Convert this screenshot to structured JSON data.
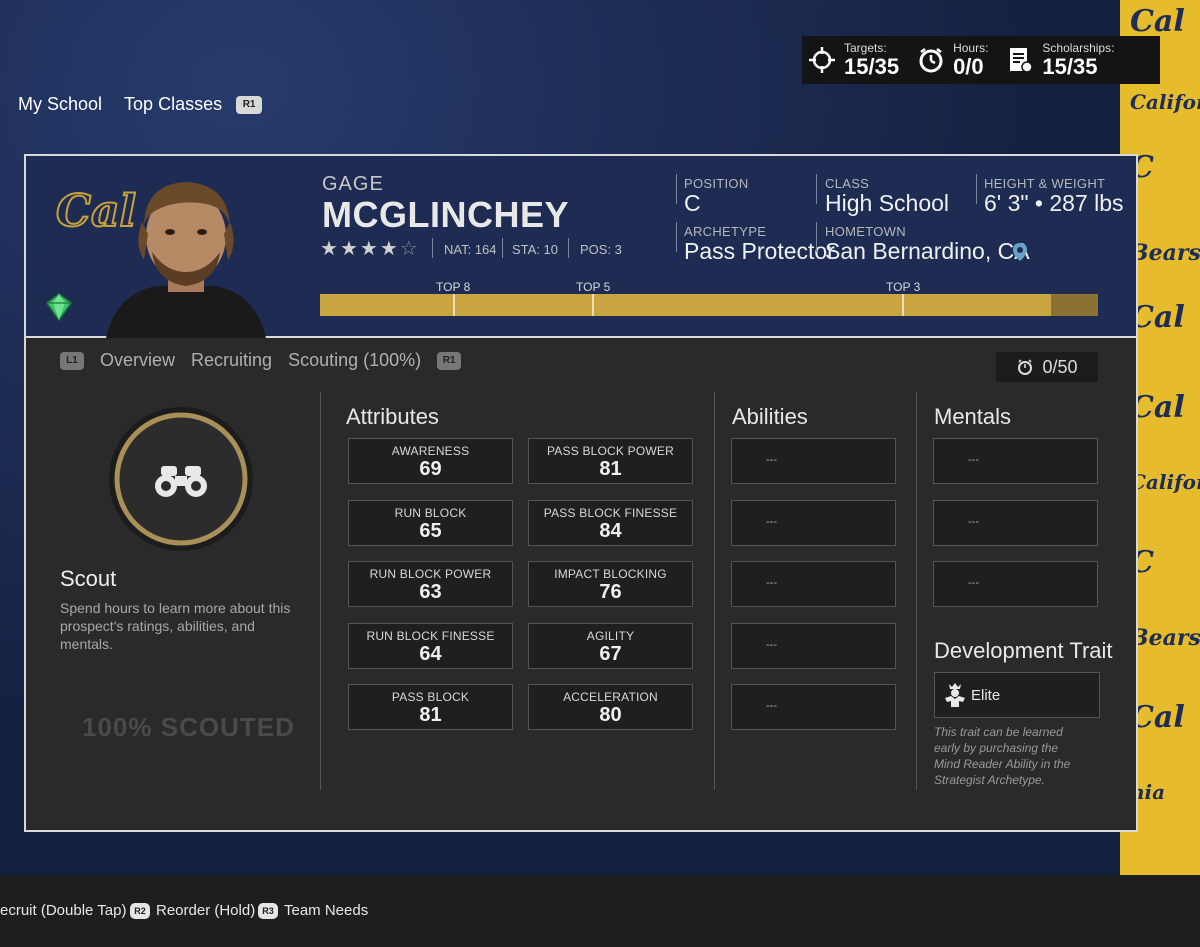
{
  "stats": {
    "targets_label": "Targets:",
    "targets_value": "15/35",
    "hours_label": "Hours:",
    "hours_value": "0/0",
    "scholarships_label": "Scholarships:",
    "scholarships_value": "15/35"
  },
  "topnav": {
    "my_school": "My School",
    "top_classes": "Top Classes",
    "r1": "R1"
  },
  "player": {
    "first_name": "GAGE",
    "last_name": "MCGLINCHEY",
    "stars": 4,
    "stars_max": 5,
    "nat": "NAT: 164",
    "sta": "STA: 10",
    "pos": "POS: 3",
    "team_logo": "Cal",
    "position_label": "POSITION",
    "position_value": "C",
    "class_label": "CLASS",
    "class_value": "High School",
    "hw_label": "HEIGHT & WEIGHT",
    "hw_value": "6' 3\" • 287 lbs",
    "archetype_label": "ARCHETYPE",
    "archetype_value": "Pass Protector",
    "hometown_label": "HOMETOWN",
    "hometown_value": "San Bernardino, CA"
  },
  "rank": {
    "top8": "TOP 8",
    "top5": "TOP 5",
    "top3": "TOP 3",
    "progress_fraction": 0.94
  },
  "tabs": {
    "l1": "L1",
    "overview": "Overview",
    "recruiting": "Recruiting",
    "scouting": "Scouting (100%)",
    "r1": "R1",
    "hours": "0/50"
  },
  "scout": {
    "title": "Scout",
    "description": "Spend hours to learn more about this prospect's ratings, abilities, and mentals.",
    "status": "100% SCOUTED"
  },
  "attributes": {
    "title": "Attributes",
    "items": [
      {
        "name": "AWARENESS",
        "value": "69"
      },
      {
        "name": "PASS BLOCK POWER",
        "value": "81"
      },
      {
        "name": "RUN BLOCK",
        "value": "65"
      },
      {
        "name": "PASS BLOCK FINESSE",
        "value": "84"
      },
      {
        "name": "RUN BLOCK POWER",
        "value": "63"
      },
      {
        "name": "IMPACT BLOCKING",
        "value": "76"
      },
      {
        "name": "RUN BLOCK FINESSE",
        "value": "64"
      },
      {
        "name": "AGILITY",
        "value": "67"
      },
      {
        "name": "PASS BLOCK",
        "value": "81"
      },
      {
        "name": "ACCELERATION",
        "value": "80"
      }
    ]
  },
  "abilities": {
    "title": "Abilities",
    "slots": [
      "---",
      "---",
      "---",
      "---",
      "---"
    ]
  },
  "mentals": {
    "title": "Mentals",
    "slots": [
      "---",
      "---",
      "---"
    ]
  },
  "development": {
    "title": "Development Trait",
    "value": "Elite",
    "description": "This trait can be learned early by purchasing the Mind Reader Ability in the Strategist Archetype."
  },
  "footer": {
    "recruit": "ecruit (Double Tap)",
    "reorder_btn": "R2",
    "reorder": "Reorder (Hold)",
    "team_needs_btn": "R3",
    "team_needs": "Team Needs"
  },
  "colors": {
    "navy": "#1e2c53",
    "gold": "#c8a53f",
    "panel": "#2a2a2a"
  }
}
